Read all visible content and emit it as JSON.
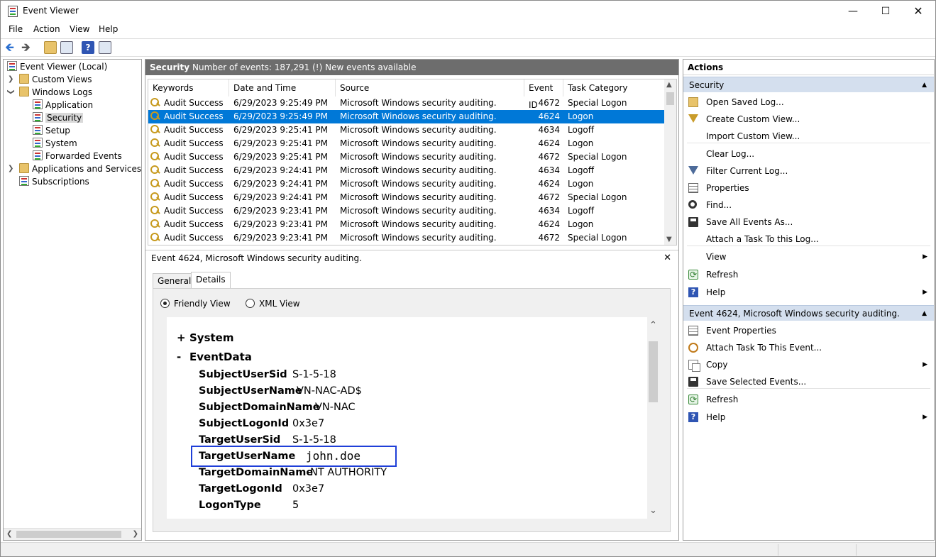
{
  "window": {
    "title": "Event Viewer"
  },
  "menu": [
    "File",
    "Action",
    "View",
    "Help"
  ],
  "tree": {
    "root": "Event Viewer (Local)",
    "custom_views": "Custom Views",
    "windows_logs": "Windows Logs",
    "logs": [
      "Application",
      "Security",
      "Setup",
      "System",
      "Forwarded Events"
    ],
    "apps_services": "Applications and Services Lo",
    "subscriptions": "Subscriptions"
  },
  "log_header": {
    "name": "Security",
    "info": "Number of events: 187,291 (!) New events available"
  },
  "grid": {
    "columns": [
      "Keywords",
      "Date and Time",
      "Source",
      "Event ID",
      "Task Category"
    ],
    "rows": [
      {
        "keywords": "Audit Success",
        "date": "6/29/2023 9:25:49 PM",
        "source": "Microsoft Windows security auditing.",
        "id": "4672",
        "category": "Special Logon"
      },
      {
        "keywords": "Audit Success",
        "date": "6/29/2023 9:25:49 PM",
        "source": "Microsoft Windows security auditing.",
        "id": "4624",
        "category": "Logon"
      },
      {
        "keywords": "Audit Success",
        "date": "6/29/2023 9:25:41 PM",
        "source": "Microsoft Windows security auditing.",
        "id": "4634",
        "category": "Logoff"
      },
      {
        "keywords": "Audit Success",
        "date": "6/29/2023 9:25:41 PM",
        "source": "Microsoft Windows security auditing.",
        "id": "4624",
        "category": "Logon"
      },
      {
        "keywords": "Audit Success",
        "date": "6/29/2023 9:25:41 PM",
        "source": "Microsoft Windows security auditing.",
        "id": "4672",
        "category": "Special Logon"
      },
      {
        "keywords": "Audit Success",
        "date": "6/29/2023 9:24:41 PM",
        "source": "Microsoft Windows security auditing.",
        "id": "4634",
        "category": "Logoff"
      },
      {
        "keywords": "Audit Success",
        "date": "6/29/2023 9:24:41 PM",
        "source": "Microsoft Windows security auditing.",
        "id": "4624",
        "category": "Logon"
      },
      {
        "keywords": "Audit Success",
        "date": "6/29/2023 9:24:41 PM",
        "source": "Microsoft Windows security auditing.",
        "id": "4672",
        "category": "Special Logon"
      },
      {
        "keywords": "Audit Success",
        "date": "6/29/2023 9:23:41 PM",
        "source": "Microsoft Windows security auditing.",
        "id": "4634",
        "category": "Logoff"
      },
      {
        "keywords": "Audit Success",
        "date": "6/29/2023 9:23:41 PM",
        "source": "Microsoft Windows security auditing.",
        "id": "4624",
        "category": "Logon"
      },
      {
        "keywords": "Audit Success",
        "date": "6/29/2023 9:23:41 PM",
        "source": "Microsoft Windows security auditing.",
        "id": "4672",
        "category": "Special Logon"
      }
    ],
    "selected_row": 1
  },
  "detail": {
    "title": "Event 4624, Microsoft Windows security auditing.",
    "tabs": [
      "General",
      "Details"
    ],
    "active_tab": "Details",
    "views": [
      "Friendly View",
      "XML View"
    ],
    "selected_view": "Friendly View",
    "system_label": "System",
    "eventdata_label": "EventData",
    "expand_plus": "+",
    "expand_minus": "-",
    "fields": [
      {
        "key": "SubjectUserSid",
        "value": "S-1-5-18"
      },
      {
        "key": "SubjectUserName",
        "value": "VN-NAC-AD$"
      },
      {
        "key": "SubjectDomainName",
        "value": "VN-NAC"
      },
      {
        "key": "SubjectLogonId",
        "value": "0x3e7"
      },
      {
        "key": "TargetUserSid",
        "value": "S-1-5-18"
      },
      {
        "key": "TargetUserName",
        "value": "john.doe"
      },
      {
        "key": "TargetDomainName",
        "value": "NT AUTHORITY"
      },
      {
        "key": "TargetLogonId",
        "value": "0x3e7"
      },
      {
        "key": "LogonType",
        "value": "5"
      }
    ]
  },
  "actions": {
    "title": "Actions",
    "section1": "Security",
    "section1_items": [
      "Open Saved Log...",
      "Create Custom View...",
      "Import Custom View...",
      "Clear Log...",
      "Filter Current Log...",
      "Properties",
      "Find...",
      "Save All Events As...",
      "Attach a Task To this Log...",
      "View",
      "Refresh",
      "Help"
    ],
    "section2": "Event 4624, Microsoft Windows security auditing.",
    "section2_items": [
      "Event Properties",
      "Attach Task To This Event...",
      "Copy",
      "Save Selected Events...",
      "Refresh",
      "Help"
    ]
  }
}
